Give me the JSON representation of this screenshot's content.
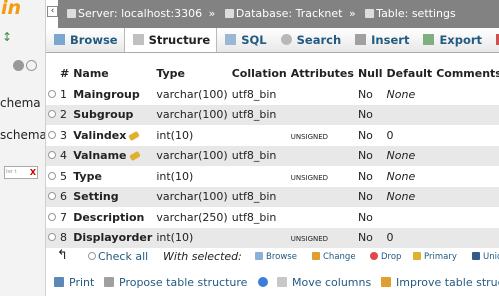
{
  "nav": {
    "logo_text": "in",
    "db_items": [
      "chema",
      "schema"
    ],
    "filter_placeholder": "ter t",
    "filter_clear": "X"
  },
  "breadcrumb": {
    "server": "Server: localhost:3306",
    "database": "Database: Tracknet",
    "table": "Table: settings",
    "separator": "»"
  },
  "tabs": [
    {
      "label": "Browse",
      "icon": "browse-icon"
    },
    {
      "label": "Structure",
      "icon": "structure-icon",
      "active": true
    },
    {
      "label": "SQL",
      "icon": "sql-icon"
    },
    {
      "label": "Search",
      "icon": "search-icon"
    },
    {
      "label": "Insert",
      "icon": "insert-icon"
    },
    {
      "label": "Export",
      "icon": "export-icon"
    }
  ],
  "table": {
    "columns": [
      "#",
      "Name",
      "Type",
      "Collation",
      "Attributes",
      "Null",
      "Default",
      "Comments"
    ],
    "rows": [
      {
        "num": "1",
        "name": "Maingroup",
        "type": "varchar(100)",
        "collation": "utf8_bin",
        "attributes": "",
        "null": "No",
        "default": "None",
        "comments": "",
        "key": false
      },
      {
        "num": "2",
        "name": "Subgroup",
        "type": "varchar(100)",
        "collation": "utf8_bin",
        "attributes": "",
        "null": "No",
        "default": "",
        "comments": "",
        "key": false
      },
      {
        "num": "3",
        "name": "Valindex",
        "type": "int(10)",
        "collation": "",
        "attributes": "UNSIGNED",
        "null": "No",
        "default": "0",
        "comments": "",
        "key": true
      },
      {
        "num": "4",
        "name": "Valname",
        "type": "varchar(100)",
        "collation": "utf8_bin",
        "attributes": "",
        "null": "No",
        "default": "None",
        "comments": "",
        "key": true
      },
      {
        "num": "5",
        "name": "Type",
        "type": "int(10)",
        "collation": "",
        "attributes": "UNSIGNED",
        "null": "No",
        "default": "None",
        "comments": "",
        "key": false
      },
      {
        "num": "6",
        "name": "Setting",
        "type": "varchar(100)",
        "collation": "utf8_bin",
        "attributes": "",
        "null": "No",
        "default": "None",
        "comments": "",
        "key": false
      },
      {
        "num": "7",
        "name": "Description",
        "type": "varchar(250)",
        "collation": "utf8_bin",
        "attributes": "",
        "null": "No",
        "default": "",
        "comments": "",
        "key": false
      },
      {
        "num": "8",
        "name": "Displayorder",
        "type": "int(10)",
        "collation": "",
        "attributes": "UNSIGNED",
        "null": "No",
        "default": "0",
        "comments": "",
        "key": false
      }
    ]
  },
  "actions": {
    "check_all": "Check all",
    "with_selected": "With selected:",
    "browse": "Browse",
    "change": "Change",
    "drop": "Drop",
    "primary": "Primary",
    "unique": "Uniq"
  },
  "footer": {
    "print": "Print",
    "propose": "Propose table structure",
    "move_columns": "Move columns",
    "improve": "Improve table structure"
  },
  "colors": {
    "breadcrumb_bg": "#828282",
    "link": "#235a81",
    "logo": "#f39c12",
    "row_alt": "#e8e8e8"
  }
}
